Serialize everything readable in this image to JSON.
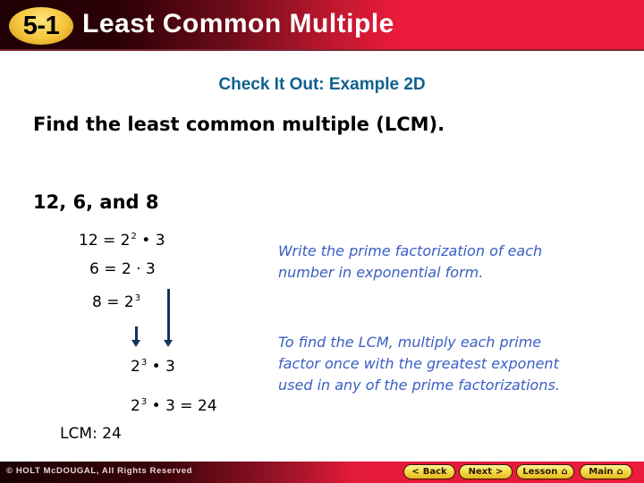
{
  "header": {
    "lesson_number": "5-1",
    "title": "Least Common Multiple"
  },
  "content": {
    "subtitle": "Check It Out: Example 2D",
    "instruction": "Find the least common multiple (LCM).",
    "problem": "12, 6, and 8",
    "factorizations": [
      {
        "lhs": "12 = 2",
        "exp": "2",
        "rest": " • 3"
      },
      {
        "lhs": "6 = 2 · 3",
        "exp": "",
        "rest": ""
      },
      {
        "lhs": "8 = 2",
        "exp": "3",
        "rest": ""
      }
    ],
    "step1": {
      "base": "2",
      "exp": "3",
      "rest": " • 3"
    },
    "step2": {
      "base": "2",
      "exp": "3",
      "rest": " • 3 = 24"
    },
    "result": "LCM: 24",
    "note1": "Write the prime factorization of each number in exponential form.",
    "note2": "To find the LCM, multiply each prime factor once with the greatest exponent used in any of the prime factorizations."
  },
  "footer": {
    "copyright": "© HOLT McDOUGAL, All Rights Reserved",
    "buttons": [
      {
        "label": "Back",
        "icon": "chevron-left"
      },
      {
        "label": "Next",
        "icon": "chevron-right"
      },
      {
        "label": "Lesson",
        "icon": "home"
      },
      {
        "label": "Main",
        "icon": "home"
      }
    ]
  },
  "colors": {
    "header_red": "#ec1a3b",
    "badge_yellow": "#f5c43a",
    "subtitle_blue": "#0f6190",
    "note_blue": "#3a5fc4",
    "arrow_navy": "#12345c"
  }
}
